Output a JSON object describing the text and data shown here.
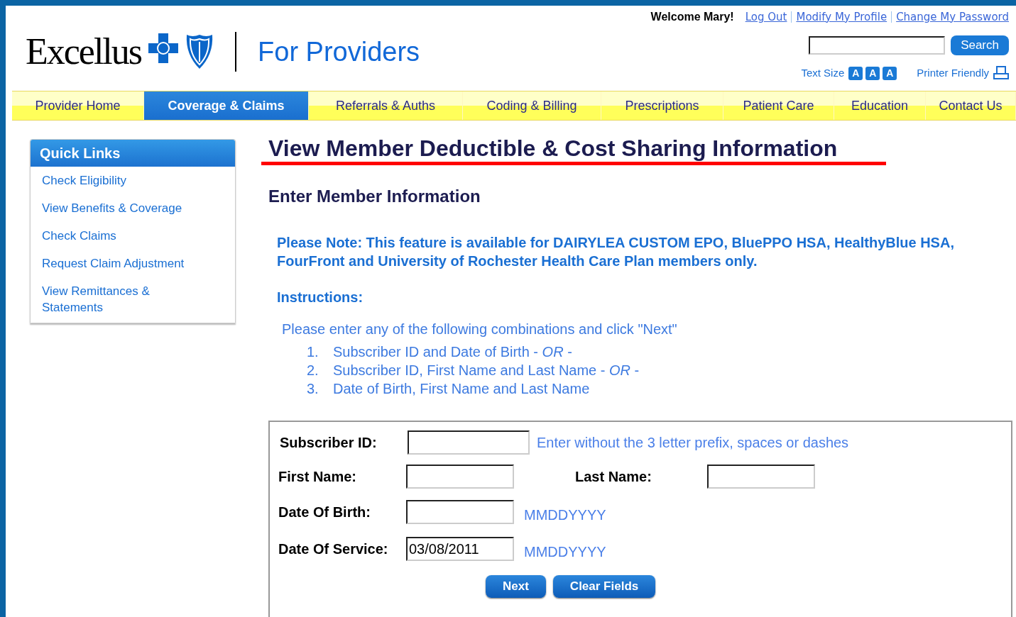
{
  "header": {
    "logo_text": "Excellus",
    "tagline": "For Providers",
    "welcome": "Welcome Mary!",
    "account_links": [
      "Log Out",
      "Modify My Profile",
      "Change My Password"
    ],
    "search": {
      "button": "Search"
    },
    "text_size": {
      "label": "Text Size",
      "sizes": [
        "A",
        "A",
        "A"
      ]
    },
    "printer_friendly": "Printer Friendly"
  },
  "nav": [
    {
      "label": "Provider Home",
      "selected": false
    },
    {
      "label": "Coverage & Claims",
      "selected": true
    },
    {
      "label": "Referrals & Auths",
      "selected": false
    },
    {
      "label": "Coding & Billing",
      "selected": false
    },
    {
      "label": "Prescriptions",
      "selected": false
    },
    {
      "label": "Patient Care",
      "selected": false
    },
    {
      "label": "Education",
      "selected": false
    },
    {
      "label": "Contact Us",
      "selected": false
    }
  ],
  "quick_links": {
    "title": "Quick Links",
    "items": [
      "Check Eligibility",
      "View Benefits & Coverage",
      "Check Claims",
      "Request Claim Adjustment",
      "View Remittances & Statements"
    ]
  },
  "main": {
    "title": "View Member Deductible & Cost Sharing Information",
    "subtitle": "Enter Member Information",
    "note": "Please Note: This feature is available for DAIRYLEA CUSTOM EPO, BluePPO HSA, HealthyBlue HSA, FourFront and University of Rochester Health Care Plan members only.",
    "instructions_heading": "Instructions:",
    "instructions_intro": "Please enter any of the following combinations and click \"Next\"",
    "combinations": [
      {
        "number": "1.",
        "text": "Subscriber ID and Date of Birth - *OR* -"
      },
      {
        "number": "2.",
        "text": "Subscriber ID, First Name and Last Name - *OR* -"
      },
      {
        "number": "3.",
        "text": "Date of Birth, First Name and Last Name"
      }
    ]
  },
  "form": {
    "subscriber_id": {
      "label": "Subscriber ID:",
      "hint": "Enter without the 3 letter prefix, spaces or dashes"
    },
    "first_name": {
      "label": "First Name:"
    },
    "last_name": {
      "label": "Last Name:"
    },
    "date_of_birth": {
      "label": "Date Of Birth:",
      "hint": "MMDDYYYY"
    },
    "date_of_service": {
      "label": "Date Of Service:",
      "value": "03/08/2011",
      "hint": "MMDDYYYY"
    },
    "buttons": [
      "Next",
      "Clear Fields"
    ]
  }
}
